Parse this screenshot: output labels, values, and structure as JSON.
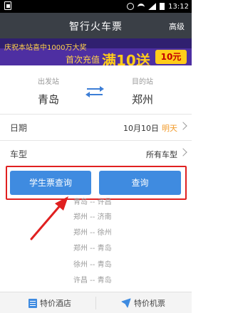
{
  "status_bar": {
    "time": "13:12"
  },
  "header": {
    "title": "智行火车票",
    "action": "高级"
  },
  "banner": {
    "line1": "庆祝本站喜中1000万大奖",
    "line2": "首次充值",
    "line3": "满10送",
    "badge": "10元",
    "colors": {
      "background": "#4e2fa2",
      "text": "#ffd14a"
    }
  },
  "stations": {
    "from_label": "出发站",
    "from_value": "青岛",
    "to_label": "目的站",
    "to_value": "郑州"
  },
  "date_row": {
    "label": "日期",
    "value": "10月10日",
    "tag": "明天"
  },
  "type_row": {
    "label": "车型",
    "value": "所有车型"
  },
  "buttons": {
    "student": "学生票查询",
    "search": "查询"
  },
  "history": [
    "青岛 -- 许昌",
    "郑州 -- 济南",
    "郑州 -- 徐州",
    "郑州 -- 青岛",
    "徐州 -- 青岛",
    "许昌 -- 青岛"
  ],
  "bottom_bar": {
    "hotel": "特价酒店",
    "flight": "特价机票"
  },
  "colors": {
    "accent": "#3f8be0",
    "header": "#3a3f46",
    "highlight": "#e02020"
  }
}
